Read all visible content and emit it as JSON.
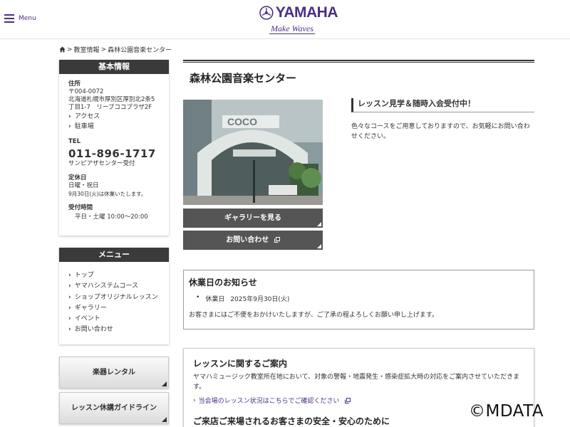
{
  "header": {
    "menu_label": "Menu",
    "brand": "YAMAHA",
    "tagline": "Make Waves"
  },
  "breadcrumb": {
    "items": [
      "教室情報",
      "森林公園音楽センター"
    ],
    "separator": ">"
  },
  "sidebar": {
    "info": {
      "heading": "基本情報",
      "address_label": "住所",
      "postal": "〒004-0072",
      "address_line1": "北海道札幌市厚別区厚別北2条5",
      "address_line2": "丁目1-7　リーブココプラザ2F",
      "links": [
        "アクセス",
        "駐車場"
      ],
      "tel_label": "TEL",
      "tel": "011-896-1717",
      "tel_note": "サンピアザセンター受付",
      "closed_label": "定休日",
      "closed_days": "日曜・祝日",
      "closed_note": "9月30日(火)は休業いたします。",
      "hours_label": "受付時間",
      "hours": "平日・土曜 10:00～20:00"
    },
    "menu": {
      "heading": "メニュー",
      "items": [
        "トップ",
        "ヤマハシステムコース",
        "ショップオリジナルレッスン",
        "ギャラリー",
        "イベント",
        "お問い合わせ"
      ]
    },
    "buttons": [
      "楽器レンタル",
      "レッスン休講ガイドライン"
    ]
  },
  "main": {
    "title": "森林公園音楽センター",
    "gallery_button": "ギャラリーを見る",
    "contact_button": "お問い合わせ",
    "lesson_heading": "レッスン見学＆随時入会受付中！",
    "lesson_desc": "色々なコースをご用意しておりますので、お気軽にお問い合わせください。",
    "notice": {
      "heading": "休業日のお知らせ",
      "bullet_label": "休業日",
      "bullet_date": "2025年9月30日(火)",
      "text": "お客さまにはご不便をおかけいたしますが、ご了承の程よろしくお願い申し上げます。"
    },
    "guide": {
      "heading": "レッスンに関するご案内",
      "text": "ヤマハミュージック教室所在地において、対象の警報・地震発生・感染症拡大時の対応をご案内させていただきます。",
      "link": "当会場のレッスン状況はこちらでご確認ください",
      "subheading": "ご来店ご来場されるお客さまの安全・安心のために"
    }
  },
  "watermark": "©MDATA",
  "colors": {
    "brand": "#4b2e83",
    "dark": "#3a3a3a",
    "button": "#555555"
  }
}
